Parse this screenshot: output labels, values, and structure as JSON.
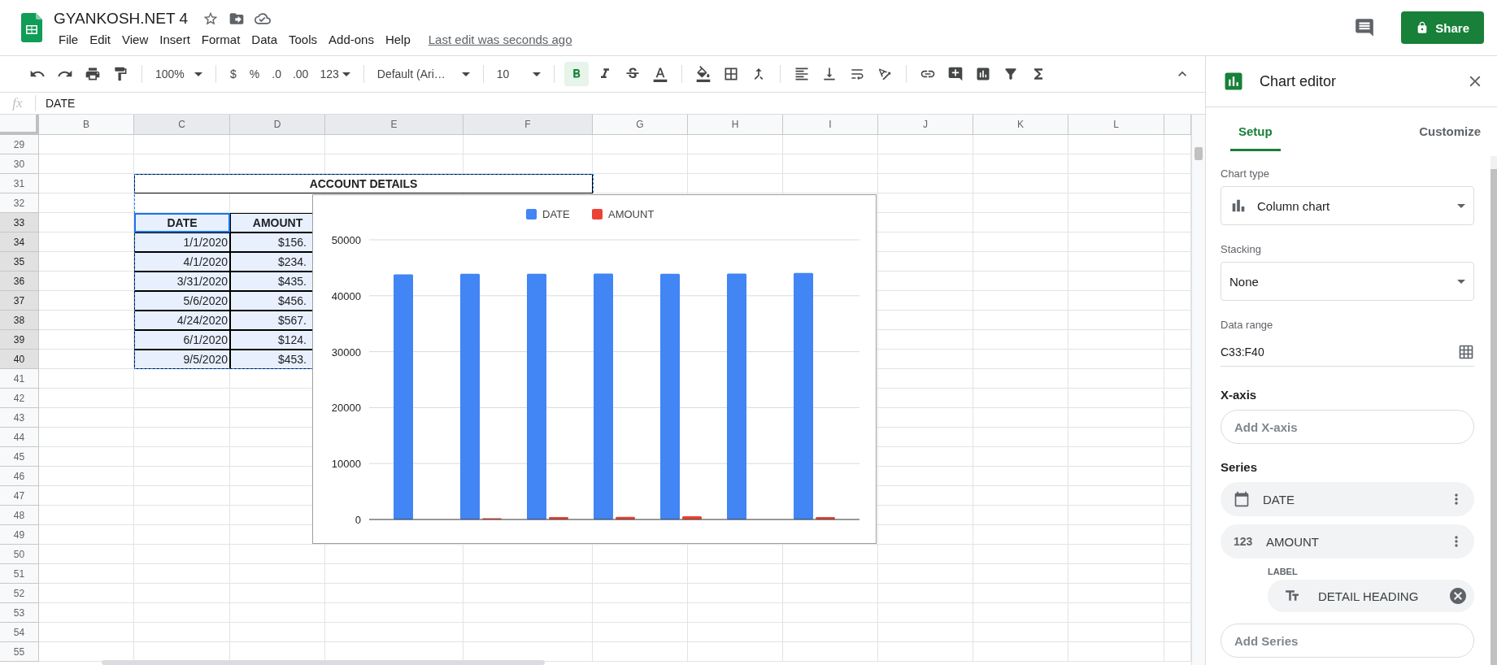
{
  "header": {
    "doc_title": "GYANKOSH.NET 4",
    "menus": [
      "File",
      "Edit",
      "View",
      "Insert",
      "Format",
      "Data",
      "Tools",
      "Add-ons",
      "Help"
    ],
    "last_edit": "Last edit was seconds ago",
    "share_label": "Share"
  },
  "toolbar": {
    "zoom": "100%",
    "currency": "$",
    "percent": "%",
    "decrease_decimals": ".0",
    "increase_decimals": ".00",
    "more_formats": "123",
    "font": "Default (Ari…",
    "font_size": "10",
    "bold_selected": true
  },
  "formula_bar": {
    "fx": "fx",
    "value": "DATE"
  },
  "sheet": {
    "columns": [
      {
        "label": "B",
        "selected": false
      },
      {
        "label": "C",
        "selected": true
      },
      {
        "label": "D",
        "selected": true
      },
      {
        "label": "E",
        "selected": true
      },
      {
        "label": "F",
        "selected": true
      },
      {
        "label": "G",
        "selected": false
      },
      {
        "label": "H",
        "selected": false
      },
      {
        "label": "I",
        "selected": false
      },
      {
        "label": "J",
        "selected": false
      },
      {
        "label": "K",
        "selected": false
      },
      {
        "label": "L",
        "selected": false
      }
    ],
    "rows": [
      {
        "number": "29",
        "selected": false
      },
      {
        "number": "30",
        "selected": false
      },
      {
        "number": "31",
        "selected": false,
        "cells": [
          {
            "kind": "title",
            "text": "ACCOUNT DETAILS",
            "active": false
          }
        ]
      },
      {
        "number": "32",
        "selected": false
      },
      {
        "number": "33",
        "selected": true,
        "cells": [
          {
            "kind": "header",
            "text": "DATE",
            "active": true
          },
          {
            "kind": "header",
            "text": "AMOUNT",
            "active": false
          }
        ]
      },
      {
        "number": "34",
        "selected": true,
        "cells": [
          {
            "kind": "value",
            "text": "1/1/2020",
            "active": false
          },
          {
            "kind": "value",
            "text": "$156.",
            "active": false
          }
        ]
      },
      {
        "number": "35",
        "selected": true,
        "cells": [
          {
            "kind": "value",
            "text": "4/1/2020",
            "active": false
          },
          {
            "kind": "value",
            "text": "$234.",
            "active": false
          }
        ]
      },
      {
        "number": "36",
        "selected": true,
        "cells": [
          {
            "kind": "value",
            "text": "3/31/2020",
            "active": false
          },
          {
            "kind": "value",
            "text": "$435.",
            "active": false
          }
        ]
      },
      {
        "number": "37",
        "selected": true,
        "cells": [
          {
            "kind": "value",
            "text": "5/6/2020",
            "active": false
          },
          {
            "kind": "value",
            "text": "$456.",
            "active": false
          }
        ]
      },
      {
        "number": "38",
        "selected": true,
        "cells": [
          {
            "kind": "value",
            "text": "4/24/2020",
            "active": false
          },
          {
            "kind": "value",
            "text": "$567.",
            "active": false
          }
        ]
      },
      {
        "number": "39",
        "selected": true,
        "cells": [
          {
            "kind": "value",
            "text": "6/1/2020",
            "active": false
          },
          {
            "kind": "value",
            "text": "$124.",
            "active": false
          }
        ]
      },
      {
        "number": "40",
        "selected": true,
        "cells": [
          {
            "kind": "value",
            "text": "9/5/2020",
            "active": false
          },
          {
            "kind": "value",
            "text": "$453.",
            "active": false
          }
        ]
      },
      {
        "number": "41",
        "selected": false
      },
      {
        "number": "42",
        "selected": false
      },
      {
        "number": "43",
        "selected": false
      },
      {
        "number": "44",
        "selected": false
      },
      {
        "number": "45",
        "selected": false
      },
      {
        "number": "46",
        "selected": false
      },
      {
        "number": "47",
        "selected": false
      },
      {
        "number": "48",
        "selected": false
      },
      {
        "number": "49",
        "selected": false
      },
      {
        "number": "50",
        "selected": false
      },
      {
        "number": "51",
        "selected": false
      },
      {
        "number": "52",
        "selected": false
      },
      {
        "number": "53",
        "selected": false
      },
      {
        "number": "54",
        "selected": false
      },
      {
        "number": "55",
        "selected": false
      }
    ],
    "chart_data": {
      "type": "bar",
      "ylim": [
        0,
        50000
      ],
      "yticks": [
        0,
        10000,
        20000,
        30000,
        40000,
        50000
      ],
      "grid": true,
      "legend": true,
      "series": [
        {
          "name": "DATE",
          "color": "#4285f4",
          "values": [
            43831,
            43922,
            43921,
            43957,
            43945,
            43983,
            44079
          ]
        },
        {
          "name": "AMOUNT",
          "color": "#ea4335",
          "values": [
            null,
            234,
            435,
            456,
            567,
            null,
            453
          ]
        }
      ]
    }
  },
  "chart_editor": {
    "title": "Chart editor",
    "tabs": [
      {
        "label": "Setup",
        "selected": true
      },
      {
        "label": "Customize",
        "selected": false
      }
    ],
    "chart_type": {
      "label": "Chart type",
      "value": "Column chart"
    },
    "stacking": {
      "label": "Stacking",
      "value": "None"
    },
    "data_range": {
      "label": "Data range",
      "value": "C33:F40"
    },
    "x_axis": {
      "label": "X-axis",
      "placeholder": "Add X-axis"
    },
    "series": {
      "label": "Series",
      "items": [
        {
          "kind": "date",
          "name": "DATE"
        },
        {
          "kind": "number",
          "icon_text": "123",
          "name": "AMOUNT",
          "sublabel": "LABEL",
          "label_chip": "DETAIL HEADING"
        }
      ],
      "add_placeholder": "Add Series"
    }
  }
}
